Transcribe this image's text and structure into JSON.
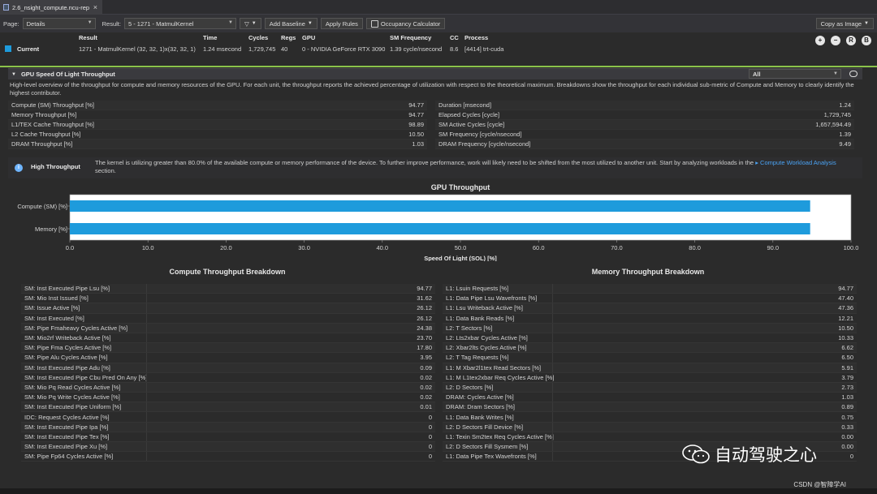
{
  "tab": {
    "title": "2.6_nsight_compute.ncu-rep",
    "close": "×"
  },
  "toolbar": {
    "page_label": "Page:",
    "page_value": "Details",
    "result_label": "Result:",
    "result_value": "5 - 1271 - MatmulKernel",
    "add_baseline": "Add Baseline",
    "apply_rules": "Apply Rules",
    "occupancy": "Occupancy Calculator",
    "copy_image": "Copy as Image"
  },
  "header": {
    "labels": {
      "result": "Result",
      "time": "Time",
      "cycles": "Cycles",
      "regs": "Regs",
      "gpu": "GPU",
      "sm_freq": "SM Frequency",
      "cc": "CC",
      "process": "Process"
    },
    "current_label": "Current",
    "values": {
      "result": "1271 - MatmulKernel (32, 32, 1)x(32, 32, 1)",
      "time": "1.24 msecond",
      "cycles": "1,729,745",
      "regs": "40",
      "gpu": "0 - NVIDIA GeForce RTX 3090",
      "sm_freq": "1.39 cycle/nsecond",
      "cc": "8.6",
      "process": "[4414] trt-cuda"
    },
    "zoom_in": "+",
    "zoom_out": "−",
    "reset": "R",
    "baseline": "B"
  },
  "section": {
    "title": "GPU Speed Of Light Throughput",
    "filter": "All",
    "description": "High-level overview of the throughput for compute and memory resources of the GPU. For each unit, the throughput reports the achieved percentage of utilization with respect to the theoretical maximum. Breakdowns show the throughput for each individual sub-metric of Compute and Memory to clearly identify the highest contributor."
  },
  "metrics_left": [
    {
      "name": "Compute (SM) Throughput [%]",
      "value": "94.77"
    },
    {
      "name": "Memory Throughput [%]",
      "value": "94.77"
    },
    {
      "name": "L1/TEX Cache Throughput [%]",
      "value": "98.89"
    },
    {
      "name": "L2 Cache Throughput [%]",
      "value": "10.50"
    },
    {
      "name": "DRAM Throughput [%]",
      "value": "1.03"
    }
  ],
  "metrics_right": [
    {
      "name": "Duration [msecond]",
      "value": "1.24"
    },
    {
      "name": "Elapsed Cycles [cycle]",
      "value": "1,729,745"
    },
    {
      "name": "SM Active Cycles [cycle]",
      "value": "1,657,594.49"
    },
    {
      "name": "SM Frequency [cycle/nsecond]",
      "value": "1.39"
    },
    {
      "name": "DRAM Frequency [cycle/nsecond]",
      "value": "9.49"
    }
  ],
  "note": {
    "title": "High Throughput",
    "text": "The kernel is utilizing greater than 80.0% of the available compute or memory performance of the device. To further improve performance, work will likely need to be shifted from the most utilized to another unit. Start by analyzing workloads in the",
    "link": "▸ Compute Workload Analysis",
    "suffix": "section."
  },
  "chart_data": {
    "type": "bar",
    "title": "GPU Throughput",
    "xlabel": "Speed Of Light (SOL) [%]",
    "ylabel": "",
    "categories": [
      "Compute (SM) [%]",
      "Memory [%]"
    ],
    "values": [
      94.77,
      94.77
    ],
    "xlim": [
      0,
      100
    ],
    "ticks": [
      "0.0",
      "10.0",
      "20.0",
      "30.0",
      "40.0",
      "50.0",
      "60.0",
      "70.0",
      "80.0",
      "90.0",
      "100.0"
    ],
    "grid": false,
    "color": "#1e9bdc"
  },
  "compute_breakdown": {
    "title": "Compute Throughput Breakdown",
    "rows": [
      {
        "name": "SM: Inst Executed Pipe Lsu [%]",
        "value": "94.77"
      },
      {
        "name": "SM: Mio Inst Issued [%]",
        "value": "31.62"
      },
      {
        "name": "SM: Issue Active [%]",
        "value": "26.12"
      },
      {
        "name": "SM: Inst Executed [%]",
        "value": "26.12"
      },
      {
        "name": "SM: Pipe Fmaheavy Cycles Active [%]",
        "value": "24.38"
      },
      {
        "name": "SM: Mio2rf Writeback Active [%]",
        "value": "23.70"
      },
      {
        "name": "SM: Pipe Fma Cycles Active [%]",
        "value": "17.80"
      },
      {
        "name": "SM: Pipe Alu Cycles Active [%]",
        "value": "3.95"
      },
      {
        "name": "SM: Inst Executed Pipe Adu [%]",
        "value": "0.09"
      },
      {
        "name": "SM: Inst Executed Pipe Cbu Pred On Any [%]",
        "value": "0.02"
      },
      {
        "name": "SM: Mio Pq Read Cycles Active [%]",
        "value": "0.02"
      },
      {
        "name": "SM: Mio Pq Write Cycles Active [%]",
        "value": "0.02"
      },
      {
        "name": "SM: Inst Executed Pipe Uniform [%]",
        "value": "0.01"
      },
      {
        "name": "IDC: Request Cycles Active [%]",
        "value": "0"
      },
      {
        "name": "SM: Inst Executed Pipe Ipa [%]",
        "value": "0"
      },
      {
        "name": "SM: Inst Executed Pipe Tex [%]",
        "value": "0"
      },
      {
        "name": "SM: Inst Executed Pipe Xu [%]",
        "value": "0"
      },
      {
        "name": "SM: Pipe Fp64 Cycles Active [%]",
        "value": "0"
      }
    ]
  },
  "memory_breakdown": {
    "title": "Memory Throughput Breakdown",
    "rows": [
      {
        "name": "L1: Lsuin Requests [%]",
        "value": "94.77"
      },
      {
        "name": "L1: Data Pipe Lsu Wavefronts [%]",
        "value": "47.40"
      },
      {
        "name": "L1: Lsu Writeback Active [%]",
        "value": "47.36"
      },
      {
        "name": "L1: Data Bank Reads [%]",
        "value": "12.21"
      },
      {
        "name": "L2: T Sectors [%]",
        "value": "10.50"
      },
      {
        "name": "L2: Lts2xbar Cycles Active [%]",
        "value": "10.33"
      },
      {
        "name": "L2: Xbar2lts Cycles Active [%]",
        "value": "6.62"
      },
      {
        "name": "L2: T Tag Requests [%]",
        "value": "6.50"
      },
      {
        "name": "L1: M Xbar2l1tex Read Sectors [%]",
        "value": "5.91"
      },
      {
        "name": "L1: M L1tex2xbar Req Cycles Active [%]",
        "value": "3.79"
      },
      {
        "name": "L2: D Sectors [%]",
        "value": "2.73"
      },
      {
        "name": "DRAM: Cycles Active [%]",
        "value": "1.03"
      },
      {
        "name": "DRAM: Dram Sectors [%]",
        "value": "0.89"
      },
      {
        "name": "L1: Data Bank Writes [%]",
        "value": "0.75"
      },
      {
        "name": "L2: D Sectors Fill Device [%]",
        "value": "0.33"
      },
      {
        "name": "L1: Texin Sm2tex Req Cycles Active [%]",
        "value": "0.00"
      },
      {
        "name": "L2: D Sectors Fill Sysmem [%]",
        "value": "0.00"
      },
      {
        "name": "L1: Data Pipe Tex Wavefronts [%]",
        "value": "0"
      }
    ]
  },
  "watermark": {
    "text": "自动驾驶之心",
    "credit": "CSDN @智障学AI"
  }
}
